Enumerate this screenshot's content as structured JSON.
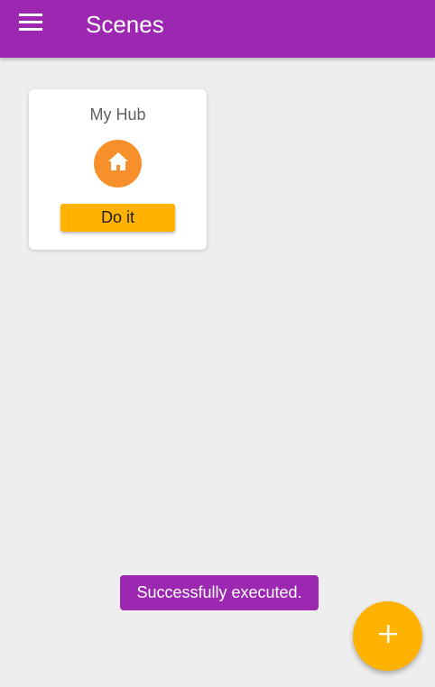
{
  "app_bar": {
    "title": "Scenes",
    "menu_icon": "hamburger-menu-icon",
    "color": "#9c27b0"
  },
  "scenes": [
    {
      "name": "My Hub",
      "icon": "home-icon",
      "icon_color": "#f7902a",
      "action_label": "Do it"
    }
  ],
  "toast": {
    "message": "Successfully executed."
  },
  "fab": {
    "icon": "plus-icon",
    "color": "#ffb300"
  }
}
